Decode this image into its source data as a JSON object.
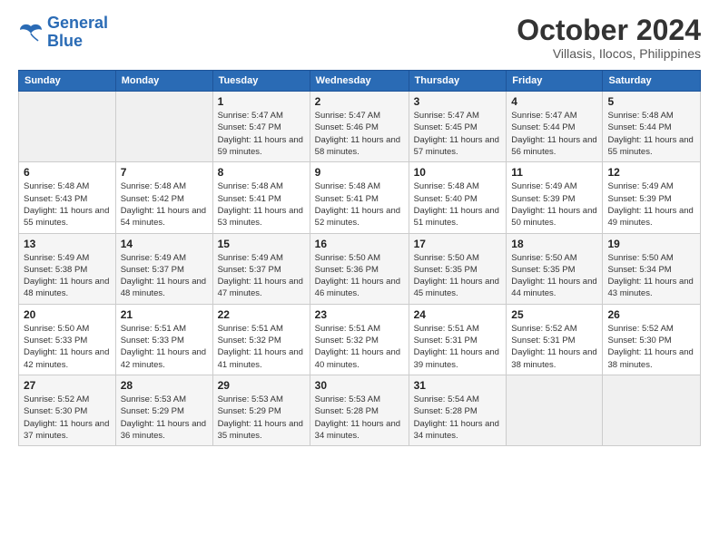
{
  "logo": {
    "line1": "General",
    "line2": "Blue"
  },
  "title": "October 2024",
  "subtitle": "Villasis, Ilocos, Philippines",
  "days_of_week": [
    "Sunday",
    "Monday",
    "Tuesday",
    "Wednesday",
    "Thursday",
    "Friday",
    "Saturday"
  ],
  "weeks": [
    [
      {
        "day": "",
        "info": ""
      },
      {
        "day": "",
        "info": ""
      },
      {
        "day": "1",
        "info": "Sunrise: 5:47 AM\nSunset: 5:47 PM\nDaylight: 11 hours and 59 minutes."
      },
      {
        "day": "2",
        "info": "Sunrise: 5:47 AM\nSunset: 5:46 PM\nDaylight: 11 hours and 58 minutes."
      },
      {
        "day": "3",
        "info": "Sunrise: 5:47 AM\nSunset: 5:45 PM\nDaylight: 11 hours and 57 minutes."
      },
      {
        "day": "4",
        "info": "Sunrise: 5:47 AM\nSunset: 5:44 PM\nDaylight: 11 hours and 56 minutes."
      },
      {
        "day": "5",
        "info": "Sunrise: 5:48 AM\nSunset: 5:44 PM\nDaylight: 11 hours and 55 minutes."
      }
    ],
    [
      {
        "day": "6",
        "info": "Sunrise: 5:48 AM\nSunset: 5:43 PM\nDaylight: 11 hours and 55 minutes."
      },
      {
        "day": "7",
        "info": "Sunrise: 5:48 AM\nSunset: 5:42 PM\nDaylight: 11 hours and 54 minutes."
      },
      {
        "day": "8",
        "info": "Sunrise: 5:48 AM\nSunset: 5:41 PM\nDaylight: 11 hours and 53 minutes."
      },
      {
        "day": "9",
        "info": "Sunrise: 5:48 AM\nSunset: 5:41 PM\nDaylight: 11 hours and 52 minutes."
      },
      {
        "day": "10",
        "info": "Sunrise: 5:48 AM\nSunset: 5:40 PM\nDaylight: 11 hours and 51 minutes."
      },
      {
        "day": "11",
        "info": "Sunrise: 5:49 AM\nSunset: 5:39 PM\nDaylight: 11 hours and 50 minutes."
      },
      {
        "day": "12",
        "info": "Sunrise: 5:49 AM\nSunset: 5:39 PM\nDaylight: 11 hours and 49 minutes."
      }
    ],
    [
      {
        "day": "13",
        "info": "Sunrise: 5:49 AM\nSunset: 5:38 PM\nDaylight: 11 hours and 48 minutes."
      },
      {
        "day": "14",
        "info": "Sunrise: 5:49 AM\nSunset: 5:37 PM\nDaylight: 11 hours and 48 minutes."
      },
      {
        "day": "15",
        "info": "Sunrise: 5:49 AM\nSunset: 5:37 PM\nDaylight: 11 hours and 47 minutes."
      },
      {
        "day": "16",
        "info": "Sunrise: 5:50 AM\nSunset: 5:36 PM\nDaylight: 11 hours and 46 minutes."
      },
      {
        "day": "17",
        "info": "Sunrise: 5:50 AM\nSunset: 5:35 PM\nDaylight: 11 hours and 45 minutes."
      },
      {
        "day": "18",
        "info": "Sunrise: 5:50 AM\nSunset: 5:35 PM\nDaylight: 11 hours and 44 minutes."
      },
      {
        "day": "19",
        "info": "Sunrise: 5:50 AM\nSunset: 5:34 PM\nDaylight: 11 hours and 43 minutes."
      }
    ],
    [
      {
        "day": "20",
        "info": "Sunrise: 5:50 AM\nSunset: 5:33 PM\nDaylight: 11 hours and 42 minutes."
      },
      {
        "day": "21",
        "info": "Sunrise: 5:51 AM\nSunset: 5:33 PM\nDaylight: 11 hours and 42 minutes."
      },
      {
        "day": "22",
        "info": "Sunrise: 5:51 AM\nSunset: 5:32 PM\nDaylight: 11 hours and 41 minutes."
      },
      {
        "day": "23",
        "info": "Sunrise: 5:51 AM\nSunset: 5:32 PM\nDaylight: 11 hours and 40 minutes."
      },
      {
        "day": "24",
        "info": "Sunrise: 5:51 AM\nSunset: 5:31 PM\nDaylight: 11 hours and 39 minutes."
      },
      {
        "day": "25",
        "info": "Sunrise: 5:52 AM\nSunset: 5:31 PM\nDaylight: 11 hours and 38 minutes."
      },
      {
        "day": "26",
        "info": "Sunrise: 5:52 AM\nSunset: 5:30 PM\nDaylight: 11 hours and 38 minutes."
      }
    ],
    [
      {
        "day": "27",
        "info": "Sunrise: 5:52 AM\nSunset: 5:30 PM\nDaylight: 11 hours and 37 minutes."
      },
      {
        "day": "28",
        "info": "Sunrise: 5:53 AM\nSunset: 5:29 PM\nDaylight: 11 hours and 36 minutes."
      },
      {
        "day": "29",
        "info": "Sunrise: 5:53 AM\nSunset: 5:29 PM\nDaylight: 11 hours and 35 minutes."
      },
      {
        "day": "30",
        "info": "Sunrise: 5:53 AM\nSunset: 5:28 PM\nDaylight: 11 hours and 34 minutes."
      },
      {
        "day": "31",
        "info": "Sunrise: 5:54 AM\nSunset: 5:28 PM\nDaylight: 11 hours and 34 minutes."
      },
      {
        "day": "",
        "info": ""
      },
      {
        "day": "",
        "info": ""
      }
    ]
  ]
}
